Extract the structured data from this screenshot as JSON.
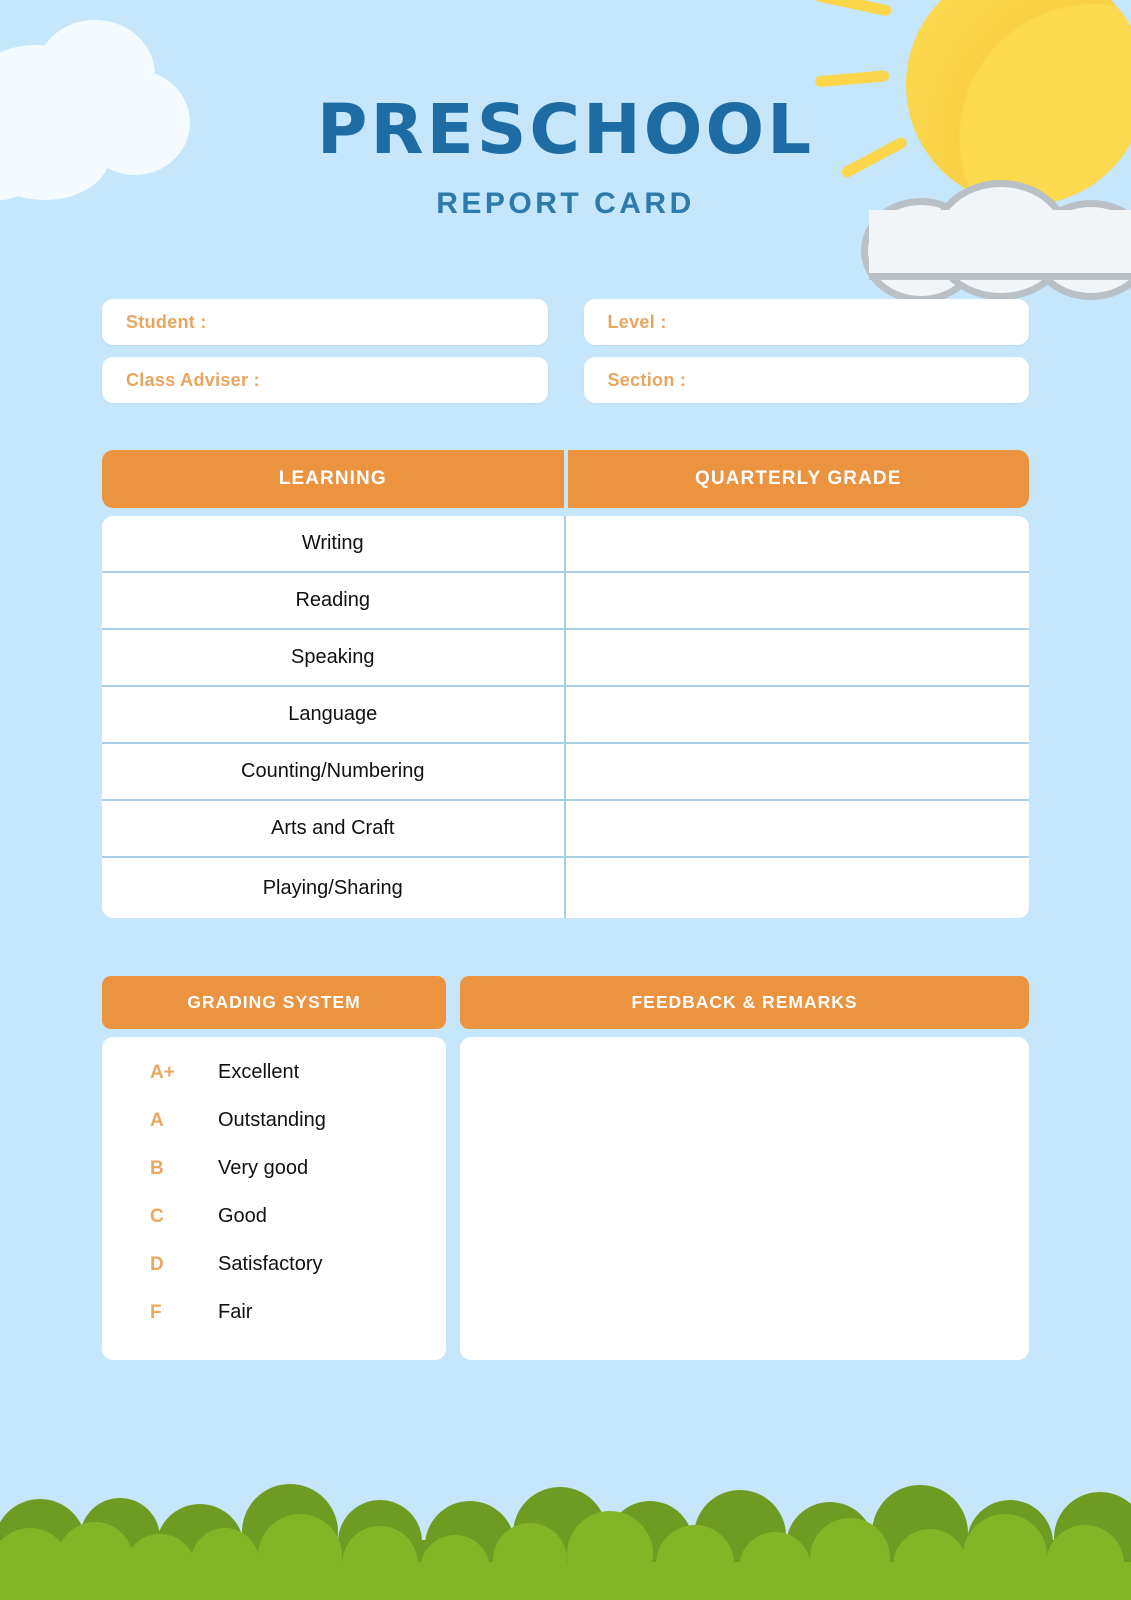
{
  "document": {
    "title_main": "PRESCHOOL",
    "title_sub": "REPORT CARD"
  },
  "colors": {
    "sky": "#c5e6fb",
    "accent_orange": "#ec933f",
    "label_orange": "#e8a560",
    "title_blue": "#1e6ca4",
    "grid_blue": "#a9cfe8",
    "bush_front": "#84b527",
    "bush_back": "#6e9c22",
    "sun_yellow": "#fcd94e"
  },
  "info_fields": [
    {
      "label": "Student :",
      "value": ""
    },
    {
      "label": "Level :",
      "value": ""
    },
    {
      "label": "Class Adviser :",
      "value": ""
    },
    {
      "label": "Section :",
      "value": ""
    }
  ],
  "learning_table": {
    "headers": [
      "LEARNING",
      "QUARTERLY GRADE"
    ],
    "rows": [
      {
        "learning": "Writing",
        "grade": ""
      },
      {
        "learning": "Reading",
        "grade": ""
      },
      {
        "learning": "Speaking",
        "grade": ""
      },
      {
        "learning": "Language",
        "grade": ""
      },
      {
        "learning": "Counting/Numbering",
        "grade": ""
      },
      {
        "learning": "Arts and Craft",
        "grade": ""
      },
      {
        "learning": "Playing/Sharing",
        "grade": ""
      }
    ]
  },
  "grading_system": {
    "header": "GRADING SYSTEM",
    "items": [
      {
        "letter": "A+",
        "description": "Excellent"
      },
      {
        "letter": "A",
        "description": "Outstanding"
      },
      {
        "letter": "B",
        "description": "Very good"
      },
      {
        "letter": "C",
        "description": "Good"
      },
      {
        "letter": "D",
        "description": "Satisfactory"
      },
      {
        "letter": "F",
        "description": "Fair"
      }
    ]
  },
  "feedback": {
    "header": "FEEDBACK & REMARKS",
    "value": ""
  }
}
